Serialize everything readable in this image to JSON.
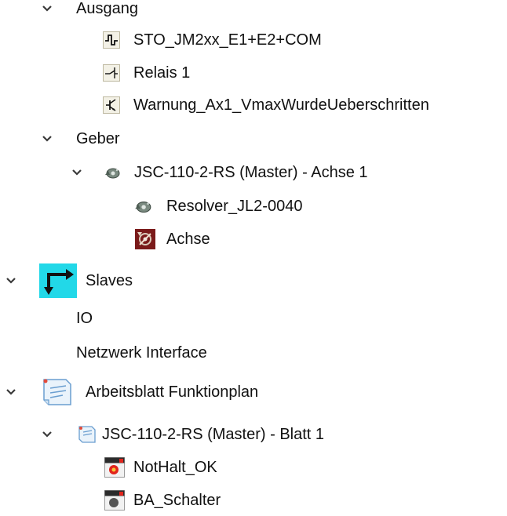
{
  "tree": {
    "nodes": {
      "ausgang": {
        "label": "Ausgang"
      },
      "sto": {
        "label": "STO_JM2xx_E1+E2+COM",
        "icon": "pulse-signal-icon"
      },
      "relais": {
        "label": "Relais 1",
        "icon": "relay-switch-icon"
      },
      "warnung": {
        "label": "Warnung_Ax1_VmaxWurdeUeberschritten",
        "icon": "transistor-icon"
      },
      "geber": {
        "label": "Geber"
      },
      "jsc_achse": {
        "label": "JSC-110-2-RS (Master) - Achse 1",
        "icon": "encoder-gear-icon"
      },
      "resolver": {
        "label": "Resolver_JL2-0040",
        "icon": "encoder-gear-icon"
      },
      "achse": {
        "label": "Achse",
        "icon": "axis-icon"
      },
      "slaves": {
        "label": "Slaves",
        "icon": "slaves-arrow-icon"
      },
      "io": {
        "label": "IO"
      },
      "netzwerk": {
        "label": "Netzwerk Interface"
      },
      "arbeitsblatt": {
        "label": "Arbeitsblatt Funktionplan",
        "icon": "notepad-icon"
      },
      "jsc_blatt": {
        "label": "JSC-110-2-RS (Master) - Blatt 1",
        "icon": "sheet-icon"
      },
      "nothalt": {
        "label": "NotHalt_OK",
        "icon": "function-block-icon"
      },
      "ba_schalter": {
        "label": "BA_Schalter",
        "icon": "function-block-icon"
      }
    }
  },
  "colors": {
    "slaves_icon_bg": "#22d8e8",
    "chevron": "#3a3a3a"
  }
}
